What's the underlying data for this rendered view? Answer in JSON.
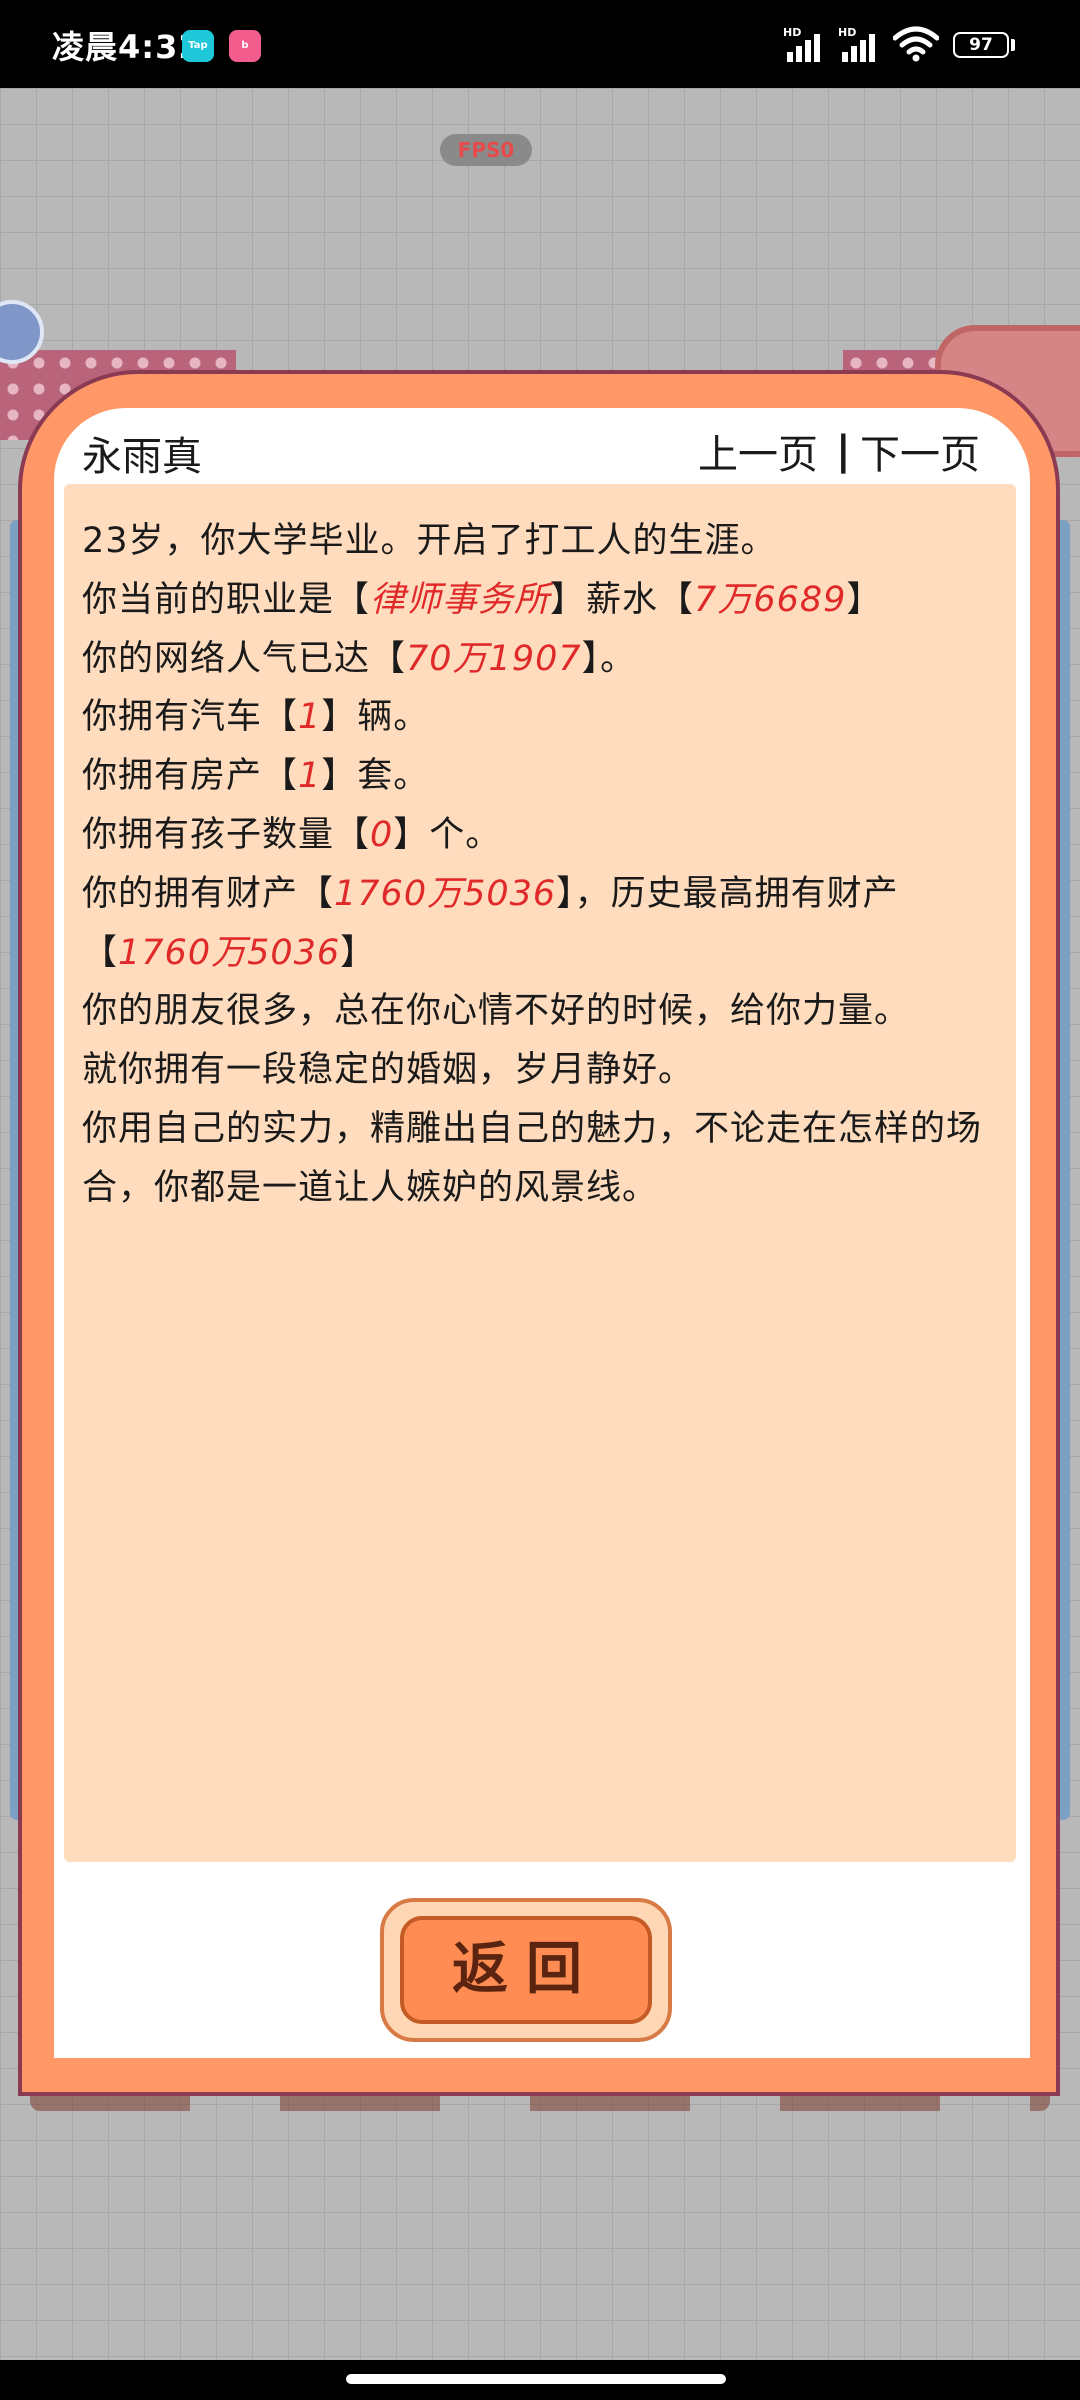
{
  "status_bar": {
    "time": "凌晨4:32",
    "app_icons": [
      "Tap",
      "bilibili"
    ],
    "signal_labels": [
      "HD",
      "HD"
    ],
    "battery": "97"
  },
  "game": {
    "fps_label": "FPS0"
  },
  "dialog": {
    "name": "永雨真",
    "prev_page": "上一页",
    "divider": "|",
    "next_page": "下一页",
    "content": {
      "line1": "23岁，你大学毕业。开启了打工人的生涯。",
      "career_prefix": "你当前的职业是【",
      "career": "律师事务所",
      "salary_prefix": "】薪水【",
      "salary": "7万6689",
      "salary_suffix": "】",
      "popularity_prefix": "你的网络人气已达【",
      "popularity": "70万1907",
      "popularity_suffix": "】。",
      "cars_prefix": "你拥有汽车【",
      "cars": "1",
      "cars_suffix": "】辆。",
      "houses_prefix": "你拥有房产【",
      "houses": "1",
      "houses_suffix": "】套。",
      "kids_prefix": "你拥有孩子数量【",
      "kids": "0",
      "kids_suffix": "】个。",
      "wealth_prefix": "你的拥有财产【",
      "wealth": "1760万5036",
      "wealth_mid": "】，历史最高拥有财产",
      "max_prefix": "【",
      "max_wealth": "1760万5036",
      "max_suffix": "】",
      "friends": "你的朋友很多，总在你心情不好的时候，给你力量。",
      "marriage": "就你拥有一段稳定的婚姻，岁月静好。",
      "charm": "你用自己的实力，精雕出自己的魅力，不论走在怎样的场合，你都是一道让人嫉妒的风景线。"
    },
    "return_label": "返回"
  },
  "colors": {
    "dialog_frame": "#ff9866",
    "panel": "#ffdcbe",
    "highlight": "#e02a2a",
    "button": "#ff8c52"
  }
}
